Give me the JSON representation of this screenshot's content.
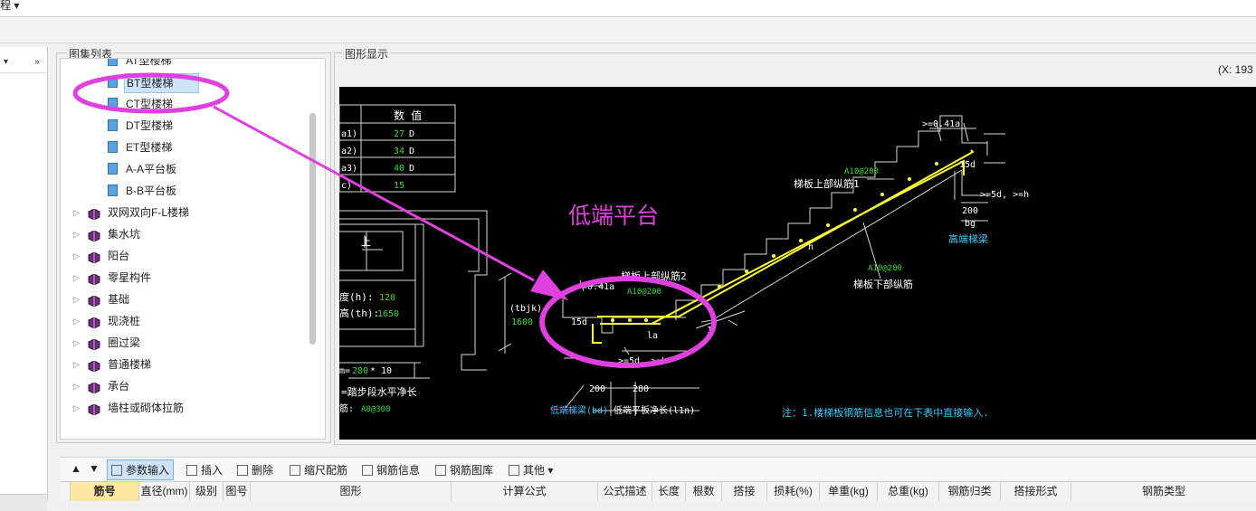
{
  "menu": {
    "label": "程 ▾"
  },
  "left": {
    "collapse": "»",
    "dropdown": "▾"
  },
  "atlas": {
    "title": "图集列表",
    "items": [
      {
        "label": "AT型楼梯",
        "type": "page"
      },
      {
        "label": "BT型楼梯",
        "type": "page",
        "selected": true
      },
      {
        "label": "CT型楼梯",
        "type": "page"
      },
      {
        "label": "DT型楼梯",
        "type": "page"
      },
      {
        "label": "ET型楼梯",
        "type": "page"
      },
      {
        "label": "A-A平台板",
        "type": "page"
      },
      {
        "label": "B-B平台板",
        "type": "page"
      },
      {
        "label": "双网双向F-L楼梯",
        "type": "book"
      },
      {
        "label": "集水坑",
        "type": "book"
      },
      {
        "label": "阳台",
        "type": "book"
      },
      {
        "label": "零星构件",
        "type": "book"
      },
      {
        "label": "基础",
        "type": "book"
      },
      {
        "label": "现浇桩",
        "type": "book"
      },
      {
        "label": "圈过梁",
        "type": "book"
      },
      {
        "label": "普通楼梯",
        "type": "book"
      },
      {
        "label": "承台",
        "type": "book"
      },
      {
        "label": "墙柱或砌体拉筋",
        "type": "book"
      }
    ]
  },
  "display": {
    "title": "图形显示",
    "coord": "(X: 193"
  },
  "drawing": {
    "table_header": "数  值",
    "rows": [
      {
        "k": "a1)",
        "v": "27",
        "u": "D"
      },
      {
        "k": "a2)",
        "v": "34",
        "u": "D"
      },
      {
        "k": "a3)",
        "v": "40",
        "u": "D"
      },
      {
        "k": "c)",
        "v": "15",
        "u": ""
      }
    ],
    "low_platform": "低端平台",
    "thickness_label": "度(h):",
    "thickness_val": "120",
    "height_label": "高(th):",
    "height_val": "1650",
    "m_label": "m=",
    "m_val": "280",
    "m_mult": "* 10",
    "step_note": "=踏步段水平净长",
    "rebar_label": "筋:",
    "rebar_val": "A8@300",
    "up": "上",
    "tbjk": "(tbjk)",
    "tbjk_val": "1600",
    "top_rebar1": "梯板上部纵筋1",
    "top_rebar2": "梯板上部纵筋2",
    "bottom_rebar": "梯板下部纵筋",
    "spec_a": "A10@200",
    "spec_b": "A10@200",
    "spec_c": "A10@200",
    "la041_top": ">=0.41a",
    "la041_low": ">=0.41a",
    "d15_top": "15d",
    "d15_low": "15d",
    "d5_top": ">=5d, >=h",
    "d5_low": ">=5d, >=h",
    "la": "la",
    "h": "h",
    "one": "1",
    "bg_val": "200",
    "bg": "bg",
    "high_beam": "高端梯梁",
    "low_beam_label": "低端梯梁(bd)",
    "low_len_label": "低端平板净长(l1n)",
    "dim200": "200",
    "dim280": "280",
    "note": "注：1.楼梯板钢筋信息也可在下表中直接输入."
  },
  "toolbar": {
    "items": [
      {
        "label": "参数输入",
        "active": true
      },
      {
        "label": "插入"
      },
      {
        "label": "删除"
      },
      {
        "label": "缩尺配筋"
      },
      {
        "label": "钢筋信息"
      },
      {
        "label": "钢筋图库"
      },
      {
        "label": "其他"
      }
    ]
  },
  "table": {
    "columns": [
      "筋号",
      "直径(mm)",
      "级别",
      "图号",
      "图形",
      "计算公式",
      "公式描述",
      "长度",
      "根数",
      "搭接",
      "损耗(%)",
      "单重(kg)",
      "总重(kg)",
      "钢筋归类",
      "搭接形式",
      "钢筋类型"
    ]
  },
  "colors": {
    "annotation": "#e040e0",
    "rebar": "#ffff33",
    "dim_green": "#33dd33",
    "cyan": "#33ccff",
    "canvas": "#000000"
  }
}
